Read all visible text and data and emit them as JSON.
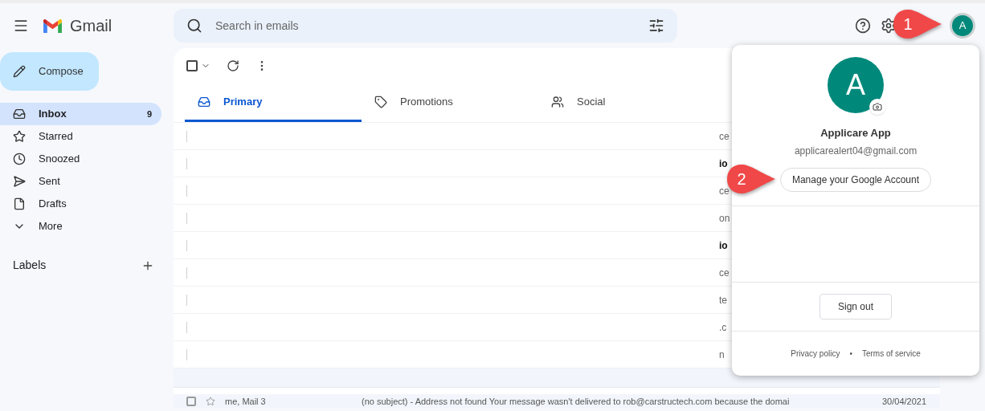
{
  "header": {
    "app_name": "Gmail",
    "search": {
      "placeholder": "Search in emails"
    },
    "avatar_letter": "A"
  },
  "compose": "Compose",
  "nav": [
    {
      "label": "Inbox",
      "count": "9",
      "selected": true
    },
    {
      "label": "Starred",
      "selected": false
    },
    {
      "label": "Snoozed",
      "selected": false
    },
    {
      "label": "Sent",
      "selected": false
    },
    {
      "label": "Drafts",
      "selected": false
    },
    {
      "label": "More",
      "selected": false
    }
  ],
  "labels_heading": "Labels",
  "tabs": [
    {
      "label": "Primary",
      "selected": true
    },
    {
      "label": "Promotions",
      "selected": false
    },
    {
      "label": "Social",
      "selected": false
    }
  ],
  "select_all": {
    "checked": false
  },
  "rows": [
    {
      "snippet": "ce",
      "unread": false
    },
    {
      "snippet": "io",
      "unread": true
    },
    {
      "snippet": "ce",
      "unread": false
    },
    {
      "snippet": "on",
      "unread": false
    },
    {
      "snippet": "io",
      "unread": true
    },
    {
      "snippet": "ce",
      "unread": false
    },
    {
      "snippet": "te",
      "unread": false
    },
    {
      "snippet": ".c",
      "unread": false
    },
    {
      "snippet": "n",
      "unread": false
    }
  ],
  "last_row": {
    "checked": false,
    "sender": "me, Mail 3",
    "text": "(no subject) - Address not found Your message wasn't delivered to rob@carstructech.com because the domai",
    "date": "30/04/2021"
  },
  "account_menu": {
    "avatar_letter": "A",
    "name": "Applicare App",
    "email": "applicarealert04@gmail.com",
    "manage": "Manage your Google Account",
    "sign_out": "Sign out",
    "links": [
      "Privacy policy",
      "Terms of service"
    ],
    "separator": "•"
  },
  "callouts": [
    {
      "number": "1"
    },
    {
      "number": "2"
    }
  ]
}
